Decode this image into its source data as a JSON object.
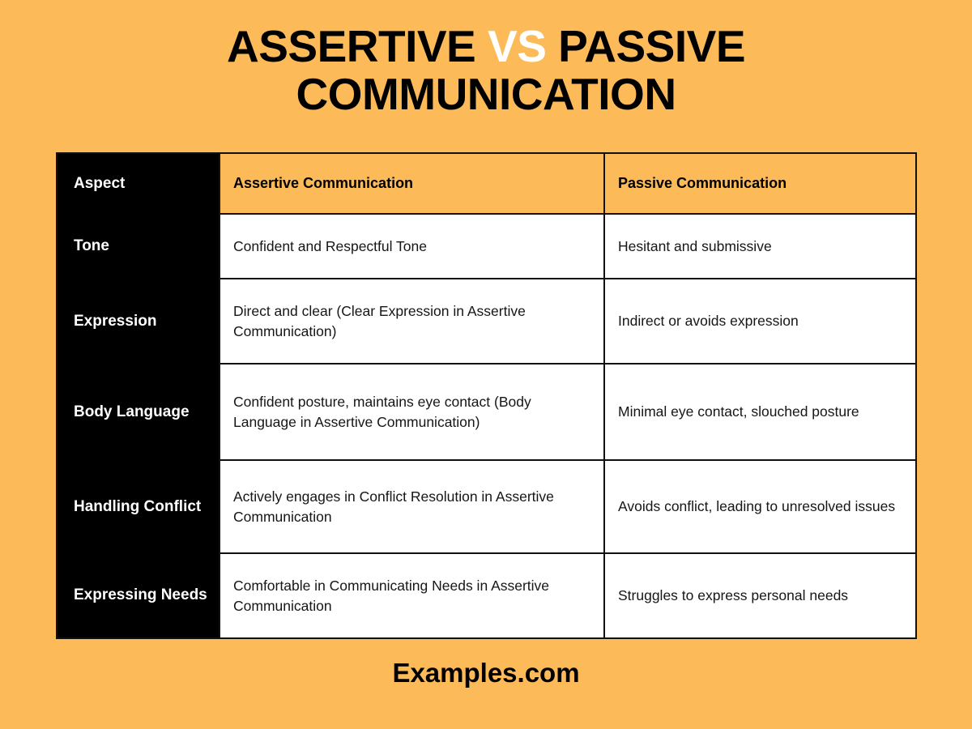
{
  "theme": {
    "background": "#fcba59",
    "header_accent": "#fcba59",
    "aspect_column_bg": "#000000",
    "cell_bg": "#ffffff",
    "border": "#111111",
    "text_dark": "#000000",
    "text_light": "#ffffff"
  },
  "title": {
    "line1_part1": "ASSERTIVE ",
    "line1_vs": "VS",
    "line1_part2": " PASSIVE",
    "line2": "COMMUNICATION"
  },
  "table": {
    "columns": [
      {
        "key": "aspect",
        "label": "Aspect"
      },
      {
        "key": "assertive",
        "label": "Assertive Communication"
      },
      {
        "key": "passive",
        "label": "Passive Communication"
      }
    ],
    "rows": [
      {
        "aspect": "Tone",
        "assertive": "Confident and Respectful Tone",
        "passive": "Hesitant and submissive"
      },
      {
        "aspect": "Expression",
        "assertive": "Direct and clear (Clear Expression in Assertive Communication)",
        "passive": "Indirect or avoids expression"
      },
      {
        "aspect": "Body Language",
        "assertive": "Confident posture, maintains eye contact (Body Language in Assertive Communication)",
        "passive": "Minimal eye contact, slouched posture"
      },
      {
        "aspect": "Handling Conflict",
        "assertive": "Actively engages in Conflict Resolution in Assertive Communication",
        "passive": "Avoids conflict, leading to unresolved issues"
      },
      {
        "aspect": "Expressing Needs",
        "assertive": "Comfortable in Communicating Needs in Assertive Communication",
        "passive": "Struggles to express personal needs"
      }
    ]
  },
  "footer": {
    "brand": "Examples.com"
  }
}
